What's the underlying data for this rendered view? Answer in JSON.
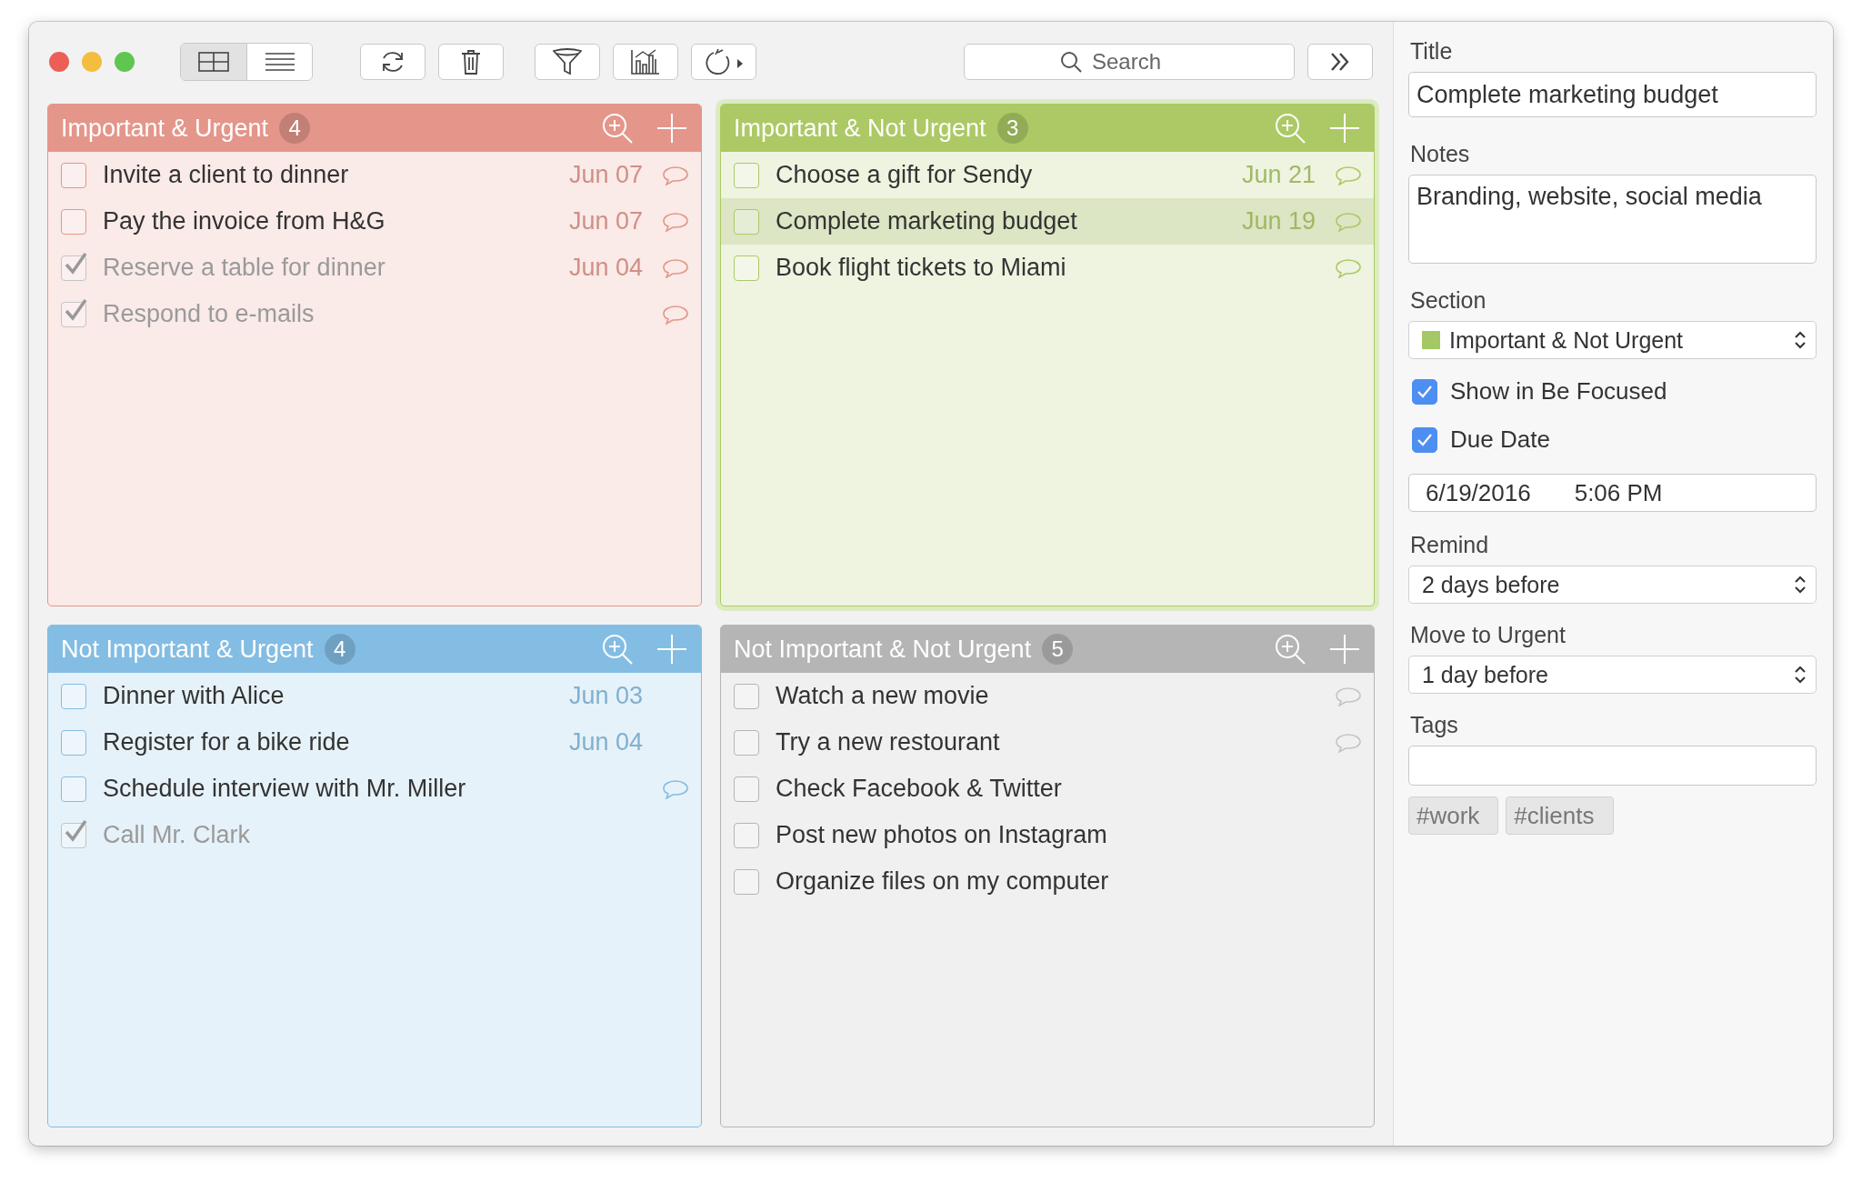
{
  "toolbar": {
    "view_modes": [
      {
        "kind": "grid",
        "selected": true
      },
      {
        "kind": "list",
        "selected": false
      }
    ],
    "tools": [
      {
        "kind": "refresh"
      },
      {
        "kind": "trash"
      },
      {
        "kind": "filter"
      },
      {
        "kind": "chart"
      },
      {
        "kind": "timer"
      }
    ],
    "search": {
      "placeholder": "Search"
    }
  },
  "quadrants": [
    {
      "title": "Important & Urgent",
      "count": "4",
      "color": "#e4968a",
      "selected": false,
      "items": [
        {
          "text": "Invite a client to dinner",
          "date": "Jun 07",
          "checked": false,
          "note": true,
          "selected": false
        },
        {
          "text": "Pay the invoice from H&G",
          "date": "Jun 07",
          "checked": false,
          "note": true,
          "selected": false
        },
        {
          "text": "Reserve a table for dinner",
          "date": "Jun 04",
          "checked": true,
          "note": true,
          "selected": false
        },
        {
          "text": "Respond to e-mails",
          "checked": true,
          "note": true,
          "selected": false
        }
      ]
    },
    {
      "title": "Important & Not Urgent",
      "count": "3",
      "color": "#acc965",
      "selected": true,
      "items": [
        {
          "text": "Choose a gift for Sendy",
          "date": "Jun 21",
          "checked": false,
          "note": true,
          "selected": false
        },
        {
          "text": "Complete marketing budget",
          "date": "Jun 19",
          "checked": false,
          "note": true,
          "selected": true
        },
        {
          "text": "Book flight tickets to Miami",
          "checked": false,
          "note": true,
          "selected": false
        }
      ]
    },
    {
      "title": "Not Important & Urgent",
      "count": "4",
      "color": "#84bde3",
      "selected": false,
      "items": [
        {
          "text": "Dinner with Alice",
          "date": "Jun 03",
          "checked": false,
          "note": false,
          "selected": false
        },
        {
          "text": "Register for a bike ride",
          "date": "Jun 04",
          "checked": false,
          "note": false,
          "selected": false
        },
        {
          "text": "Schedule interview with Mr. Miller",
          "checked": false,
          "note": true,
          "selected": false
        },
        {
          "text": "Call Mr. Clark",
          "checked": true,
          "note": false,
          "selected": false
        }
      ]
    },
    {
      "title": "Not Important & Not Urgent",
      "count": "5",
      "color": "#b5b5b5",
      "selected": false,
      "items": [
        {
          "text": "Watch a new movie",
          "checked": false,
          "note": true,
          "selected": false
        },
        {
          "text": "Try a new restourant",
          "checked": false,
          "note": true,
          "selected": false
        },
        {
          "text": "Check Facebook & Twitter",
          "checked": false,
          "note": false,
          "selected": false
        },
        {
          "text": "Post new photos on Instagram",
          "checked": false,
          "note": false,
          "selected": false
        },
        {
          "text": "Organize files on my computer",
          "checked": false,
          "note": false,
          "selected": false
        }
      ]
    }
  ],
  "details": {
    "title_label": "Title",
    "title_value": "Complete marketing budget",
    "notes_label": "Notes",
    "notes_value": "Branding, website, social media",
    "section_label": "Section",
    "section": {
      "value": "Important & Not Urgent",
      "color": "#a3c865"
    },
    "checkboxes": [
      {
        "label": "Show in Be Focused",
        "checked": true
      },
      {
        "label": "Due Date",
        "checked": true
      }
    ],
    "due_date": "6/19/2016",
    "due_time": "5:06 PM",
    "remind_label": "Remind",
    "remind_value": "2 days before",
    "move_label": "Move to Urgent",
    "move_value": "1 day before",
    "tags_label": "Tags",
    "tags": [
      "#work",
      "#clients"
    ]
  }
}
